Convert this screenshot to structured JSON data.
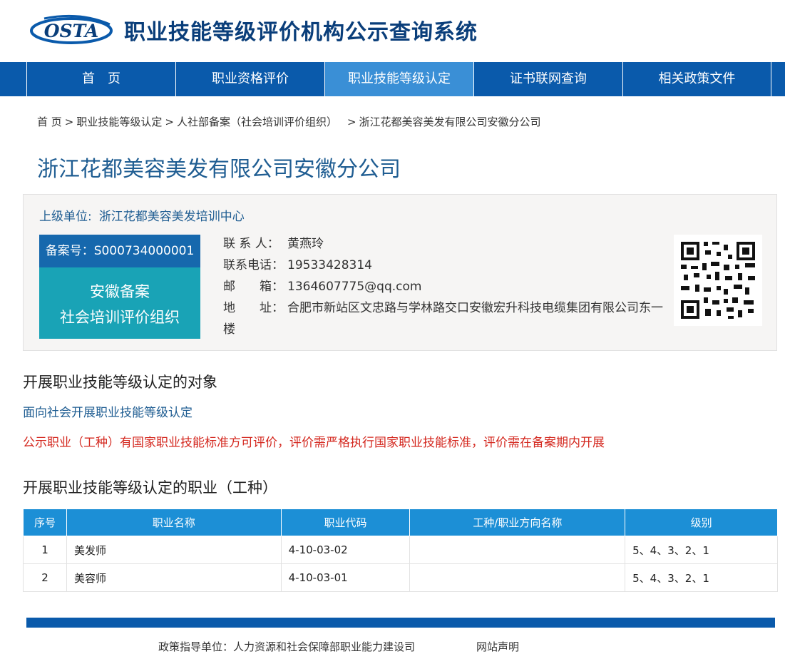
{
  "header": {
    "logo_text": "OSTA",
    "title": "职业技能等级评价机构公示查询系统"
  },
  "nav": {
    "items": [
      {
        "label": "首　页"
      },
      {
        "label": "职业资格评价"
      },
      {
        "label": "职业技能等级认定"
      },
      {
        "label": "证书联网查询"
      },
      {
        "label": "相关政策文件"
      }
    ]
  },
  "breadcrumb": {
    "items": [
      "首 页",
      "职业技能等级认定",
      "人社部备案（社会培训评价组织）",
      "浙江花都美容美发有限公司安徽分公司"
    ],
    "separator": ">"
  },
  "org": {
    "name": "浙江花都美容美发有限公司安徽分公司",
    "parent_label": "上级单位:",
    "parent_value": "浙江花都美容美发培训中心",
    "record_no": "备案号：S000734000001",
    "record_type_line1": "安徽备案",
    "record_type_line2": "社会培训评价组织",
    "contact_label": "联 系 人：",
    "contact_value": "黄燕玲",
    "phone_label": "联系电话：",
    "phone_value": "19533428314",
    "email_label": "邮　　箱：",
    "email_value": "1364607775@qq.com",
    "address_label": "地　　址：",
    "address_value": "合肥市新站区文忠路与学林路交口安徽宏升科技电缆集团有限公司东一楼"
  },
  "section_object": {
    "title": "开展职业技能等级认定的对象",
    "subtitle": "面向社会开展职业技能等级认定",
    "notice": "公示职业（工种）有国家职业技能标准方可评价，评价需严格执行国家职业技能标准，评价需在备案期内开展"
  },
  "section_occupations": {
    "title": "开展职业技能等级认定的职业（工种）",
    "headers": [
      "序号",
      "职业名称",
      "职业代码",
      "工种/职业方向名称",
      "级别"
    ],
    "rows": [
      {
        "no": "1",
        "name": "美发师",
        "code": "4-10-03-02",
        "direction": "",
        "level": "5、4、3、2、1"
      },
      {
        "no": "2",
        "name": "美容师",
        "code": "4-10-03-01",
        "direction": "",
        "level": "5、4、3、2、1"
      }
    ]
  },
  "footer": {
    "guidance": "政策指导单位：人力资源和社会保障部职业能力建设司",
    "statement": "网站声明"
  },
  "colors": {
    "nav_bg": "#0a5aab",
    "nav_active": "#3a8fd6",
    "title_blue": "#1f5d92",
    "notice_red": "#d4281f",
    "record_no_bg": "#1668ad",
    "record_type_bg": "#19a3b6",
    "table_head": "#1c8fd6"
  }
}
